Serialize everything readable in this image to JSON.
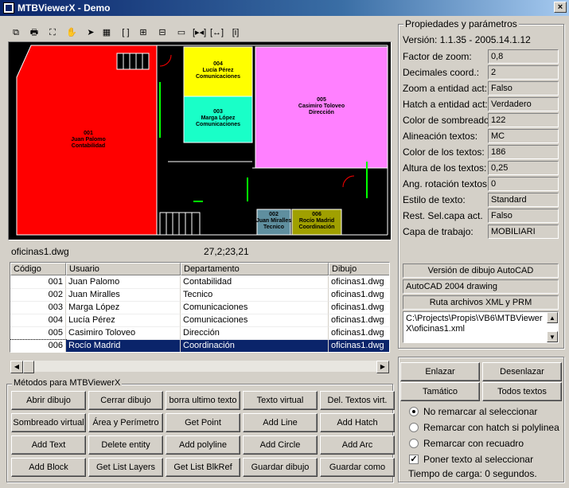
{
  "window": {
    "title": "MTBViewerX - Demo",
    "close": "×"
  },
  "toolbar": {
    "icons": [
      "copy-icon",
      "print-icon",
      "zoom-extents-icon",
      "pan-icon",
      "select-pointer-icon",
      "properties-icon",
      "zoom-window-icon",
      "zoom-in-icon",
      "zoom-out-icon",
      "rectangle-icon",
      "fit-width-icon",
      "fit-height-icon",
      "info-icon"
    ],
    "glyphs": [
      "⧉",
      "🖶",
      "⛶",
      "✋",
      "➤",
      "▦",
      "[ ]",
      "⊞",
      "⊟",
      "▭",
      "[▸◂]",
      "[↔]",
      "[i]"
    ]
  },
  "drawing": {
    "rooms": [
      {
        "code": "001",
        "name": "Juan Palomo",
        "dept": "Contabilidad"
      },
      {
        "code": "004",
        "name": "Lucía Pérez",
        "dept": "Comunicaciones"
      },
      {
        "code": "003",
        "name": "Marga López",
        "dept": "Comunicaciones"
      },
      {
        "code": "005",
        "name": "Casimiro Toloveo",
        "dept": "Dirección"
      },
      {
        "code": "002",
        "name": "Juan Miralles",
        "dept": "Tecnico"
      },
      {
        "code": "006",
        "name": "Rocío Madrid",
        "dept": "Coordinación"
      }
    ],
    "colors": {
      "red": "#ff0000",
      "yellow": "#ffff00",
      "teal": "#19ffc8",
      "magenta": "#ff80ff",
      "slate": "#5f8f9f",
      "olive": "#a0a000"
    }
  },
  "status": {
    "file": "oficinas1.dwg",
    "coords": "27,2;23,21"
  },
  "table": {
    "headers": [
      "Código",
      "Usuario",
      "Departamento",
      "Dibujo"
    ],
    "rows": [
      [
        "001",
        "Juan Palomo",
        "Contabilidad",
        "oficinas1.dwg"
      ],
      [
        "002",
        "Juan Miralles",
        "Tecnico",
        "oficinas1.dwg"
      ],
      [
        "003",
        "Marga López",
        "Comunicaciones",
        "oficinas1.dwg"
      ],
      [
        "004",
        "Lucía Pérez",
        "Comunicaciones",
        "oficinas1.dwg"
      ],
      [
        "005",
        "Casimiro Toloveo",
        "Dirección",
        "oficinas1.dwg"
      ],
      [
        "006",
        "Rocío Madrid",
        "Coordinación",
        "oficinas1.dwg"
      ]
    ],
    "selected_row": 5
  },
  "methods": {
    "legend": "Métodos para MTBViewerX",
    "buttons": [
      [
        "Abrir dibujo",
        "Cerrar dibujo",
        "borra ultimo texto",
        "Texto virtual",
        "Del. Textos virt."
      ],
      [
        "Sombreado virtual",
        "Área y Perímetro",
        "Get Point",
        "Add Line",
        "Add Hatch"
      ],
      [
        "Add Text",
        "Delete entity",
        "Add polyline",
        "Add Circle",
        "Add Arc"
      ],
      [
        "Add Block",
        "Get List Layers",
        "Get List BlkRef",
        "Guardar dibujo",
        "Guardar como"
      ]
    ]
  },
  "props": {
    "legend": "Propiedades y parámetros",
    "version": "Versión: 1.1.35 - 2005.14.1.12",
    "items": [
      {
        "label": "Factor de zoom:",
        "value": "0,8"
      },
      {
        "label": "Decimales coord.:",
        "value": "2"
      },
      {
        "label": "Zoom a entidad act:",
        "value": "Falso"
      },
      {
        "label": "Hatch a entidad act:",
        "value": "Verdadero"
      },
      {
        "label": "Color de sombreado:",
        "value": "122"
      },
      {
        "label": "Alineación textos:",
        "value": "MC"
      },
      {
        "label": "Color de los textos:",
        "value": "186"
      },
      {
        "label": "Altura de los textos:",
        "value": "0,25"
      },
      {
        "label": "Ang. rotación textos:",
        "value": "0"
      },
      {
        "label": "Estilo de texto:",
        "value": "Standard"
      },
      {
        "label": "Rest. Sel.capa act.",
        "value": "Falso"
      },
      {
        "label": "Capa de trabajo:",
        "value": "MOBILIARI"
      }
    ],
    "autocad_label": "Versión de dibujo AutoCAD",
    "autocad_value": "AutoCAD 2004 drawing",
    "route_label": "Ruta archivos XML y PRM",
    "route_value": "C:\\Projects\\Propis\\VB6\\MTBViewerX\\oficinas1.xml"
  },
  "links": {
    "buttons": [
      "Enlazar",
      "Desenlazar",
      "Tamático",
      "Todos textos"
    ],
    "options": [
      {
        "label": "No remarcar al seleccionar",
        "type": "radio",
        "checked": true
      },
      {
        "label": "Remarcar con hatch si polylinea",
        "type": "radio",
        "checked": false
      },
      {
        "label": "Remarcar con recuadro",
        "type": "radio",
        "checked": false
      },
      {
        "label": "Poner texto al seleccionar",
        "type": "check",
        "checked": true
      }
    ],
    "load_time": "Tiempo de carga:  0 segundos."
  }
}
